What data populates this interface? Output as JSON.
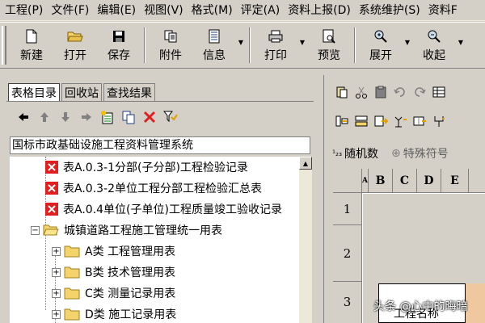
{
  "menubar": {
    "items": [
      "工程(P)",
      "文件(F)",
      "编辑(E)",
      "视图(V)",
      "格式(M)",
      "评定(A)",
      "资料上报(D)",
      "系统维护(S)",
      "资料F"
    ]
  },
  "toolbar": {
    "new": "新建",
    "open": "打开",
    "save": "保存",
    "attach": "附件",
    "info": "信息",
    "print": "打印",
    "preview": "预览",
    "expand": "展开",
    "collapse": "收起"
  },
  "left": {
    "tabs": [
      "表格目录",
      "回收站",
      "查找结果"
    ],
    "path": "国标市政基础设施工程资料管理系统",
    "tree": [
      {
        "label": "表A.0.3-1分部(子分部)工程检验记录",
        "kind": "doc"
      },
      {
        "label": "表A.0.3-2单位工程分部工程检验汇总表",
        "kind": "doc"
      },
      {
        "label": "表A.0.4单位(子单位)工程质量竣工验收记录",
        "kind": "doc"
      },
      {
        "label": "城镇道路工程施工管理统一用表",
        "kind": "folder"
      },
      {
        "label": "A类 工程管理用表",
        "kind": "folder"
      },
      {
        "label": "B类 技术管理用表",
        "kind": "folder"
      },
      {
        "label": "C类 测量记录用表",
        "kind": "folder"
      },
      {
        "label": "D类 施工记录用表",
        "kind": "folder"
      }
    ]
  },
  "right": {
    "random_label": "随机数",
    "special_label": "特殊符号",
    "columns": [
      "B",
      "C",
      "D",
      "E"
    ],
    "rows": [
      "1",
      "2",
      "3"
    ],
    "cell_text": "工程名称"
  },
  "watermark": "头条 @心中的晦暗",
  "colors": {
    "error_icon": "#e02020",
    "folder": "#f5d36b",
    "chrome": "#d4d0c8"
  }
}
